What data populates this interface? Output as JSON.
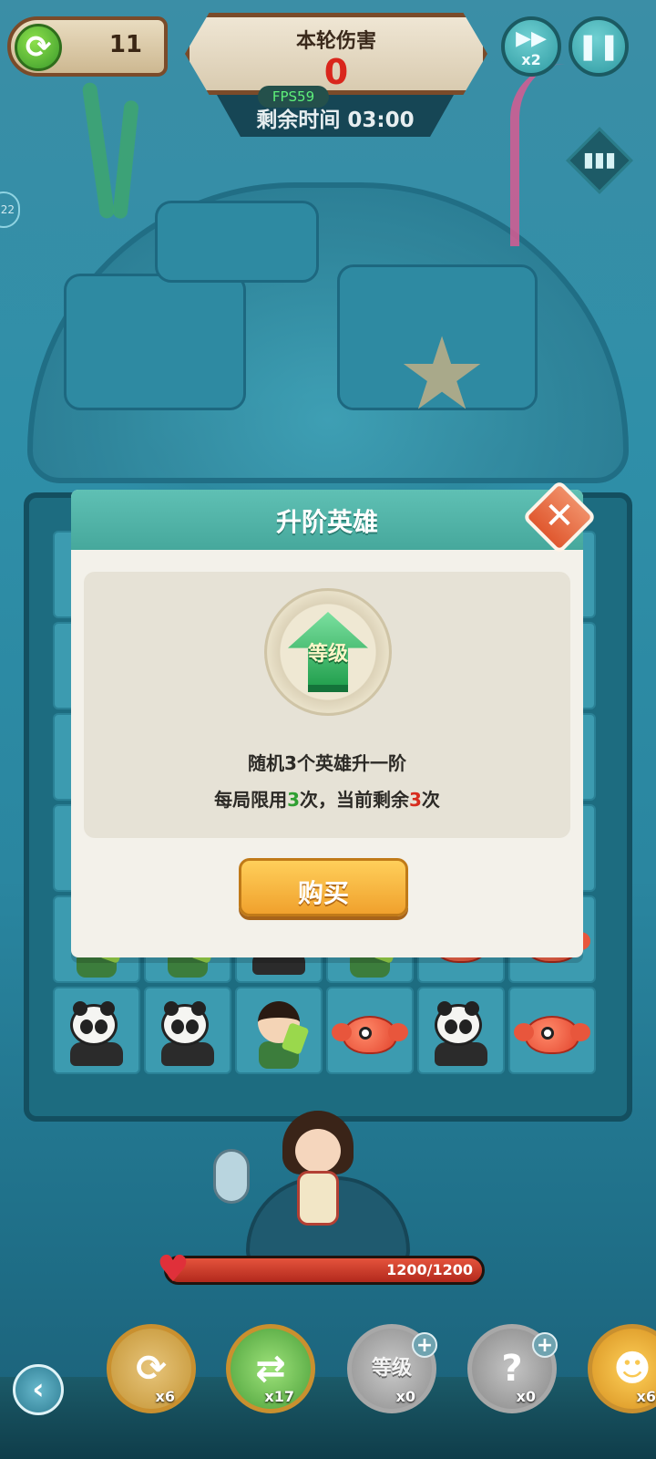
{
  "hud": {
    "refresh_count": "11",
    "damage_title": "本轮伤害",
    "damage_value": "0",
    "fps": "FPS59",
    "time_remaining": "剩余时间 03:00",
    "speed_label": "x2",
    "side_badge": "22"
  },
  "dialog": {
    "title": "升阶英雄",
    "emblem_label": "等级",
    "desc_line1": "随机3个英雄升一阶",
    "desc_line2_prefix": "每局限用",
    "limit_total": "3",
    "desc_line2_middle": "次，当前剩余",
    "limit_remaining": "3",
    "desc_line2_suffix": "次",
    "buy_label": "购买"
  },
  "player": {
    "hp_text": "1200/1200",
    "hp_fraction": 1.0
  },
  "board": {
    "rows": [
      [
        "hidden",
        "hidden",
        "hidden",
        "hidden",
        "hidden",
        "hidden"
      ],
      [
        "hidden",
        "hidden",
        "hidden",
        "hidden",
        "hidden",
        "hidden"
      ],
      [
        "hidden",
        "hidden",
        "hidden",
        "hidden",
        "hidden",
        "hidden"
      ],
      [
        "hidden",
        "hidden",
        "hidden",
        "hidden",
        "hidden",
        "hidden"
      ],
      [
        "girl",
        "girl",
        "panda",
        "girl",
        "fish",
        "fish"
      ],
      [
        "panda",
        "panda",
        "girl",
        "fish",
        "panda",
        "fish"
      ]
    ]
  },
  "toolbar": {
    "items": [
      {
        "icon": "board-refresh-icon",
        "count": "x6"
      },
      {
        "icon": "recycle-plus-icon",
        "count": "x17"
      },
      {
        "icon": "level-up-icon",
        "label": "等级",
        "count": "x0"
      },
      {
        "icon": "hero-swap-icon",
        "count": "x0"
      },
      {
        "icon": "golden-hero-icon",
        "count": "x6"
      }
    ]
  },
  "colors": {
    "dialog_header": "#46a89c",
    "buy_button": "#f0a12d",
    "close_button": "#e0582f",
    "limit_total": "#2f9f32",
    "limit_remaining": "#d72c1e",
    "hp_fill": "#d9402e"
  }
}
